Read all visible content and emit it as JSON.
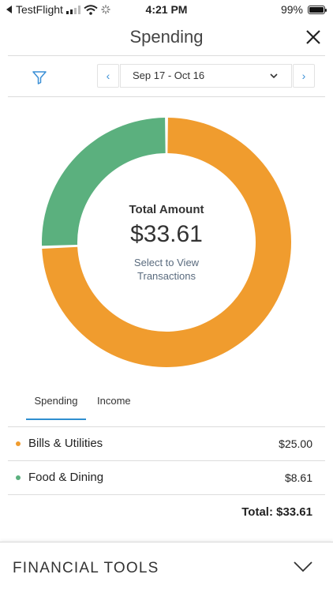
{
  "status_bar": {
    "back_app": "TestFlight",
    "time": "4:21 PM",
    "battery": "99%",
    "battery_level": 0.99
  },
  "header": {
    "title": "Spending",
    "close_icon": "close-icon"
  },
  "filter": {
    "filter_icon": "filter-icon",
    "prev_label": "‹",
    "next_label": "›",
    "date_range": "Sep 17 - Oct 16"
  },
  "donut": {
    "title": "Total Amount",
    "amount": "$33.61",
    "link_line1": "Select to View",
    "link_line2": "Transactions"
  },
  "tabs": [
    {
      "label": "Spending",
      "active": true
    },
    {
      "label": "Income",
      "active": false
    }
  ],
  "colors": {
    "bills": "#f09c2e",
    "food": "#5bb07e",
    "accent": "#2f8fd0"
  },
  "chart_data": {
    "type": "pie",
    "categories": [
      "Bills & Utilities",
      "Food & Dining"
    ],
    "values": [
      25.0,
      8.61
    ],
    "colors": [
      "#f09c2e",
      "#5bb07e"
    ]
  },
  "categories": [
    {
      "name": "Bills & Utilities",
      "value": "$25.00"
    },
    {
      "name": "Food & Dining",
      "value": "$8.61"
    }
  ],
  "total": "Total: $33.61",
  "footer": {
    "title": "FINANCIAL TOOLS",
    "chevron_icon": "chevron-down-icon"
  }
}
